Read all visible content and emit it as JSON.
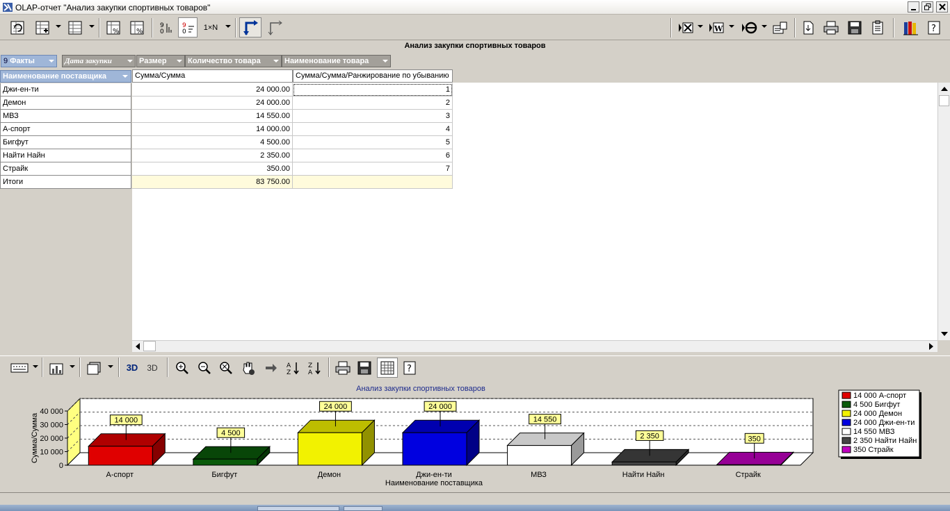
{
  "window": {
    "title": "OLAP-отчет \"Анализ закупки спортивных товаров\""
  },
  "toolbar": {
    "count_label": "1×N"
  },
  "report_title": "Анализ закупки спортивных товаров",
  "fields": {
    "facts": "Факты",
    "date": "Дата закупки",
    "size": "Размер",
    "quantity": "Количество товара",
    "product": "Наименование товара",
    "supplier": "Наименование поставщика"
  },
  "grid": {
    "col_sum": "Сумма/Сумма",
    "col_rank": "Сумма/Сумма/Ранжирование по убыванию",
    "rows": [
      {
        "name": "Джи-ен-ти",
        "sum": "24 000.00",
        "rank": "1"
      },
      {
        "name": "Демон",
        "sum": "24 000.00",
        "rank": "2"
      },
      {
        "name": "МВЗ",
        "sum": "14 550.00",
        "rank": "3"
      },
      {
        "name": "А-спорт",
        "sum": "14 000.00",
        "rank": "4"
      },
      {
        "name": "Бигфут",
        "sum": "4 500.00",
        "rank": "5"
      },
      {
        "name": "Найти Найн",
        "sum": "2 350.00",
        "rank": "6"
      },
      {
        "name": "Страйк",
        "sum": "350.00",
        "rank": "7"
      }
    ],
    "total_label": "Итоги",
    "total_sum": "83 750.00"
  },
  "chart_toolbar": {
    "label_3d_a": "3D",
    "label_3d_b": "3D"
  },
  "chart_data": {
    "type": "bar",
    "title": "Анализ закупки спортивных товаров",
    "xlabel": "Наименование поставщика",
    "ylabel": "Сумма/Сумма",
    "ylim": [
      0,
      40000
    ],
    "yticks": [
      "0",
      "10 000",
      "20 000",
      "30 000",
      "40 000"
    ],
    "categories": [
      "А-спорт",
      "Бигфут",
      "Демон",
      "Джи-ен-ти",
      "МВЗ",
      "Найти Найн",
      "Страйк"
    ],
    "values": [
      14000,
      4500,
      24000,
      24000,
      14550,
      2350,
      350
    ],
    "value_labels": [
      "14 000",
      "4 500",
      "24 000",
      "24 000",
      "14 550",
      "2 350",
      "350"
    ],
    "colors": [
      "#e00000",
      "#0a5a0a",
      "#f2f200",
      "#0000e0",
      "#ffffff",
      "#444444",
      "#c000c0"
    ],
    "legend_position": "right",
    "legend": [
      "14 000 А-спорт",
      "4 500 Бигфут",
      "24 000 Демон",
      "24 000 Джи-ен-ти",
      "14 550 МВЗ",
      "2 350 Найти Найн",
      "350 Страйк"
    ],
    "grid": true,
    "three_d": true
  }
}
